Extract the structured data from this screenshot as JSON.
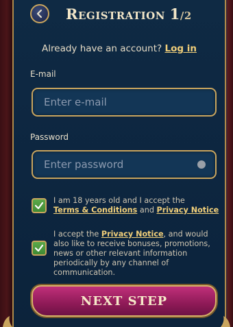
{
  "header": {
    "title_main": "Registration",
    "title_step": "1",
    "title_total": "/2"
  },
  "account_prompt": {
    "text": "Already have an account?",
    "link": "Log in"
  },
  "email": {
    "label": "E-mail",
    "placeholder": "Enter e-mail"
  },
  "password": {
    "label": "Password",
    "placeholder": "Enter password"
  },
  "consent_age": {
    "text_1": "I am 18 years old and I accept the",
    "link_terms": "Terms & Conditions",
    "text_and": "and",
    "link_privacy": "Privacy Notice",
    "checked": true
  },
  "consent_marketing": {
    "text_1": "I accept the",
    "link_privacy": "Privacy Notice",
    "text_2": ", and would also like to receive bonuses, promotions, news or other relevant information periodically by any channel of communication.",
    "checked": true
  },
  "next_button": {
    "label": "NEXT STEP"
  },
  "colors": {
    "panel": "#0d2640",
    "gold": "#c9a55e",
    "link": "#f1cf7a",
    "checkbox": "#4f9b40",
    "button": "#a0205f"
  }
}
